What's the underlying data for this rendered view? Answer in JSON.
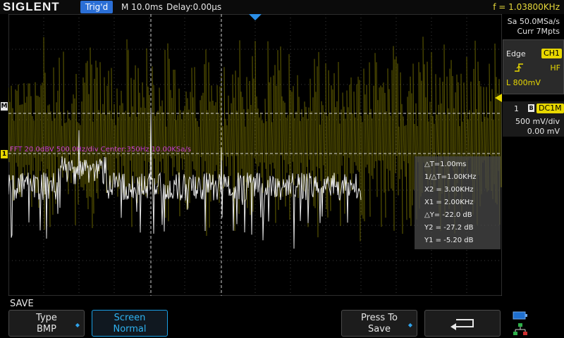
{
  "top_bar": {
    "brand": "SIGLENT",
    "trigger_status": "Trig'd",
    "timebase": "M 10.0ms",
    "delay": "Delay:0.00μs",
    "frequency": "f = 1.03800KHz"
  },
  "right_panel": {
    "sample_rate": "Sa 50.0MSa/s",
    "memory_depth": "Curr 7Mpts",
    "trigger_type": "Edge",
    "trigger_source": "CH1",
    "trigger_coupling": "HF",
    "trigger_level": "L  800mV",
    "channel_number": "1",
    "channel_bandwidth_icon": "B",
    "channel_coupling": "DC1M",
    "volts_per_div": "500 mV/div",
    "offset": "0.00 mV"
  },
  "markers": {
    "math_marker": "M",
    "ch1_marker": "1"
  },
  "fft_info": "FFT  20.0dBV  500.0Hz/div  Center:350Hz  10.00KSa/s",
  "measurements": {
    "delta_t": "△T=1.00ms",
    "inv_delta_t": "1/△T=1.00KHz",
    "x2": "X2 = 3.00KHz",
    "x1": "X1 = 2.00KHz",
    "delta_y": "△Y= -22.0 dB",
    "y2": "Y2 = -27.2 dB",
    "y1": "Y1 = -5.20 dB"
  },
  "menu": {
    "title": "SAVE",
    "type_label": "Type",
    "type_value": "BMP",
    "screen_label": "Screen",
    "screen_value": "Normal",
    "press_label": "Press To",
    "press_value": "Save"
  },
  "colors": {
    "ch1": "#e8d800",
    "math": "#c63bd0",
    "accent": "#2b6fd6"
  }
}
